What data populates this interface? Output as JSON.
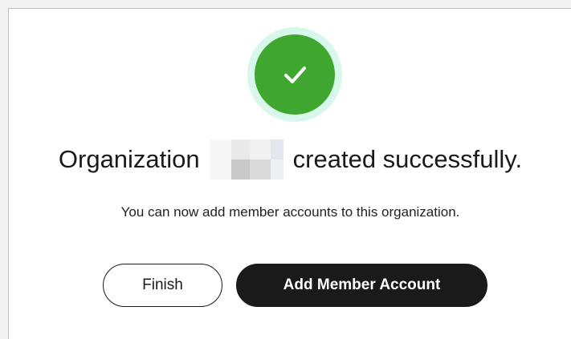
{
  "dialog": {
    "title_prefix": "Organization",
    "title_suffix": "created successfully.",
    "message": "You can now add member accounts to this organization.",
    "status_icon": "checkmark-icon",
    "colors": {
      "success_green": "#3fa62f",
      "success_halo": "#d6f7ea",
      "primary_button": "#1a1a1a"
    }
  },
  "buttons": {
    "finish_label": "Finish",
    "add_member_label": "Add Member Account"
  }
}
